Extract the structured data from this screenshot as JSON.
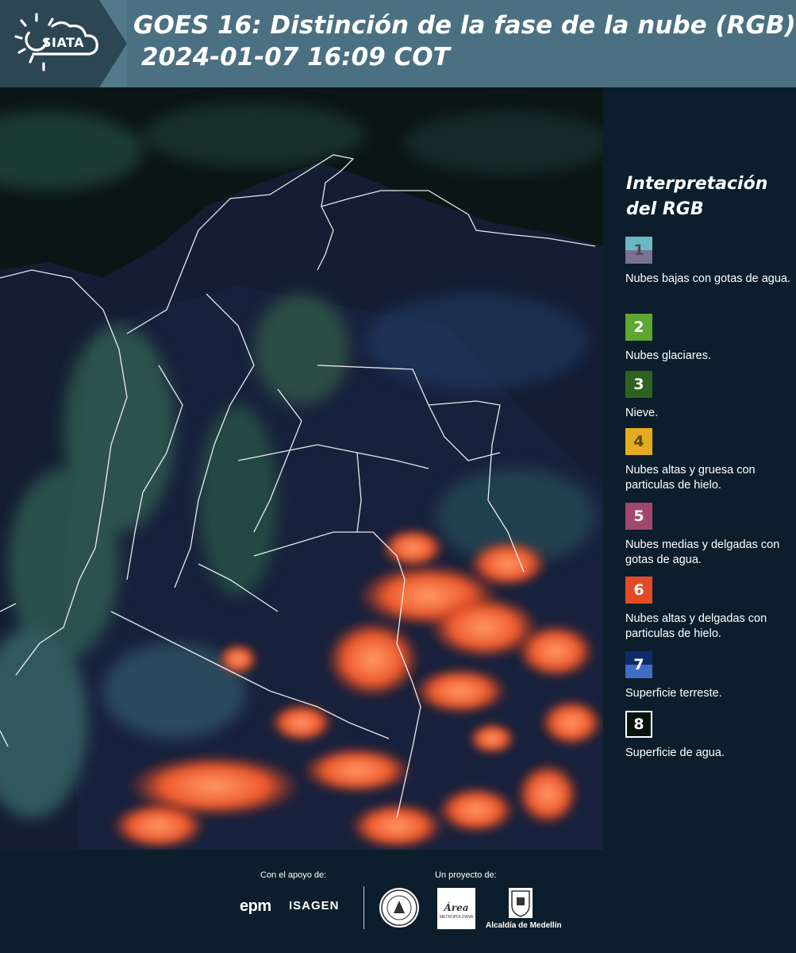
{
  "header": {
    "logo_text": "SIATA",
    "title": "GOES 16: Distinción de la fase de la nube (RGB)",
    "subtitle": "2024-01-07 16:09 COT"
  },
  "legend": {
    "title": "Interpretación del RGB",
    "items": [
      {
        "number": "1",
        "label": "Nubes bajas con gotas de agua.",
        "color_top": "#6ab8c6",
        "color_bottom": "#7a7190",
        "text_color": "#4a4a5a"
      },
      {
        "number": "2",
        "label": "Nubes glaciares.",
        "color": "#5fa531",
        "text_color": "#ffffff"
      },
      {
        "number": "3",
        "label": "Nieve.",
        "color": "#2f6220",
        "text_color": "#ffffff"
      },
      {
        "number": "4",
        "label": "Nubes altas y gruesa con particulas de hielo.",
        "color": "#e4ab1e",
        "text_color": "#5a4a10"
      },
      {
        "number": "5",
        "label": "Nubes medias y delgadas con gotas de agua.",
        "color": "#a2466f",
        "text_color": "#ffffff"
      },
      {
        "number": "6",
        "label": "Nubes altas y delgadas con particulas de hielo.",
        "color": "#e54a26",
        "text_color": "#ffffff"
      },
      {
        "number": "7",
        "label": "Superficie terreste.",
        "color_top": "#102a6b",
        "color_bottom": "#3f6cc4",
        "text_color": "#ffffff"
      },
      {
        "number": "8",
        "label": "Superficie de agua.",
        "color": "#0a120c",
        "text_color": "#ffffff"
      }
    ]
  },
  "footer": {
    "support_label": "Con el apoyo de:",
    "project_label": "Un proyecto de:",
    "epm_logo": "epm",
    "isagen_logo": "ISAGEN",
    "area_logo_text": "Área",
    "area_logo_subtext": "METROPOLITANA",
    "alcaldia_label": "Alcaldía de Medellín"
  }
}
